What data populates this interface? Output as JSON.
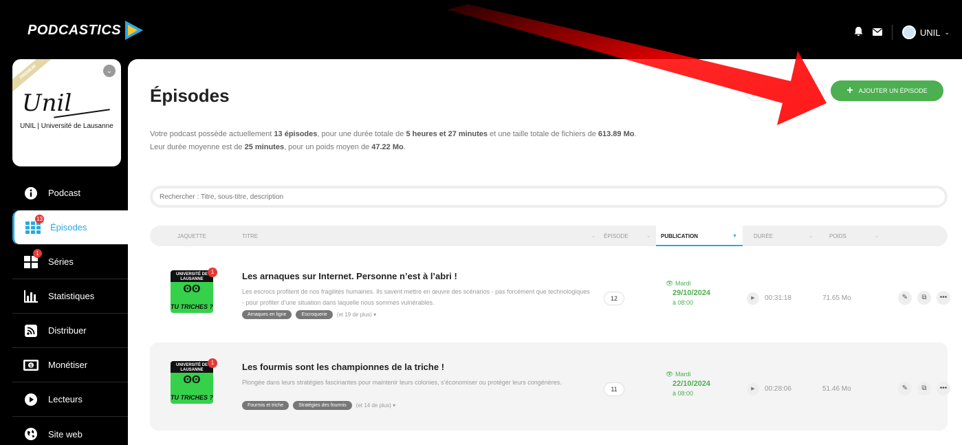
{
  "header": {
    "logo_text": "PODCASTICS",
    "user_label": "UNIL",
    "icons": [
      "bell-icon",
      "envelope-icon",
      "chevron-down-icon"
    ]
  },
  "podcast_card": {
    "premium_label": "PREMIUM",
    "script_text": "Unil",
    "subtitle": "UNIL | Université de Lausanne"
  },
  "sidebar": {
    "items": [
      {
        "label": "Podcast",
        "icon": "info-icon"
      },
      {
        "label": "Épisodes",
        "icon": "grid-icon",
        "badge": "13",
        "active": true
      },
      {
        "label": "Séries",
        "icon": "squares-icon",
        "badge": "1"
      },
      {
        "label": "Statistiques",
        "icon": "bar-chart-icon"
      },
      {
        "label": "Distribuer",
        "icon": "rss-icon"
      },
      {
        "label": "Monétiser",
        "icon": "money-icon"
      },
      {
        "label": "Lecteurs",
        "icon": "play-icon"
      },
      {
        "label": "Site web",
        "icon": "globe-icon"
      }
    ]
  },
  "main": {
    "title": "Épisodes",
    "add_button": "AJOUTER UN ÉPISODE",
    "summary": {
      "l1_a": "Votre podcast possède actuellement ",
      "l1_b": "13 épisodes",
      "l1_c": ", pour une durée totale de ",
      "l1_d": "5 heures et 27 minutes",
      "l1_e": " et une taille totale de fichiers de ",
      "l1_f": "613.89 Mo",
      "l1_g": ".",
      "l2_a": "Leur durée moyenne est de ",
      "l2_b": "25 minutes",
      "l2_c": ", pour un poids moyen de ",
      "l2_d": "47.22 Mo",
      "l2_e": "."
    },
    "search_placeholder": "Rechercher : Titre, sous-titre, description",
    "columns": {
      "cover": "JAQUETTE",
      "title": "TITRE",
      "episode": "ÉPISODE",
      "publication": "PUBLICATION",
      "duration": "DURÉE",
      "size": "POIDS"
    },
    "episodes": [
      {
        "cover_top": "UNIVERSITÉ DE LAUSANNE",
        "cover_eyes": "ʘʘ",
        "cover_bottom": "TU TRICHES ?",
        "cover_badge": "1",
        "title": "Les arnaques sur Internet. Personne n’est à l’abri !",
        "description": "Les escrocs profitent de nos fragilités humaines. Ils savent mettre en œuvre des scénarios - pas forcément que technologiques - pour profiter d’une situation dans laquelle nous sommes vulnérables.",
        "tags": [
          "Arnaques en ligne",
          "Escroquerie"
        ],
        "more_tags": "(et 19 de plus) ▾",
        "episode_number": "12",
        "pub_day": "Mardi",
        "pub_date": "29/10/2024",
        "pub_time": "à 08:00",
        "duration": "00:31:18",
        "size": "71.65 Mo"
      },
      {
        "cover_top": "UNIVERSITÉ DE LAUSANNE",
        "cover_eyes": "ʘʘ",
        "cover_bottom": "TU TRICHES ?",
        "cover_badge": "1",
        "title": "Les fourmis sont les championnes de la triche !",
        "description": "Plongée dans leurs stratégies fascinantes pour maintenir leurs colonies, s’économiser ou protéger leurs congénères.",
        "tags": [
          "Fourmis et triche",
          "Stratégies des fourmis"
        ],
        "more_tags": "(et 14 de plus) ▾",
        "episode_number": "11",
        "pub_day": "Mardi",
        "pub_date": "22/10/2024",
        "pub_time": "à 08:00",
        "duration": "00:28:06",
        "size": "51.46 Mo"
      }
    ]
  },
  "colors": {
    "accent": "#2aa8e0",
    "green": "#4caf50",
    "badge_red": "#e53935",
    "annotation_red": "#ff0000"
  }
}
